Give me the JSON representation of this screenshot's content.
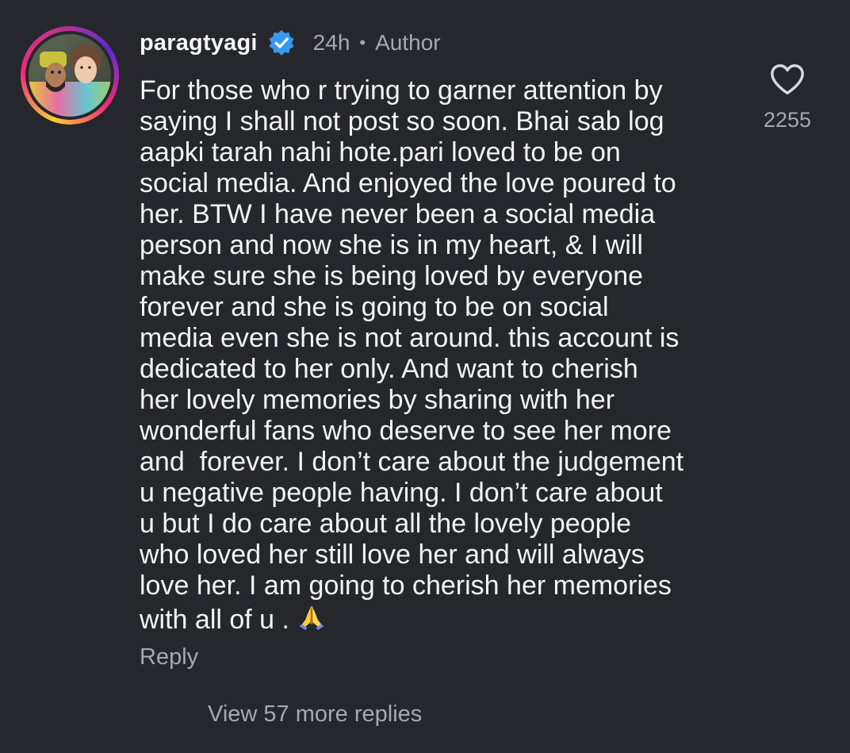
{
  "comment": {
    "username": "paragtyagi",
    "verified_icon": "verified-badge-icon",
    "time": "24h",
    "separator": "•",
    "role": "Author",
    "text": "For those who r trying to garner attention by\nsaying I shall not post so soon. Bhai sab log\naapki tarah nahi hote.pari loved to be on\nsocial media. And enjoyed the love poured to\nher. BTW I have never been a social media\nperson and now she is in my heart, & I will\nmake sure she is being loved by everyone\nforever and she is going to be on social\nmedia even she is not around. this account is\ndedicated to her only. And want to cherish\nher lovely memories by sharing with her\nwonderful fans who deserve to see her more\nand  forever. I don’t care about the judgement\nu negative people having. I don’t care about\nu but I do care about all the lovely people\nwho loved her still love her and will always\nlove her. I am going to cherish her memories\nwith all of u . ",
    "emoji": "folded-hands-emoji",
    "like_icon": "heart-outline-icon",
    "like_count": "2255",
    "reply_label": "Reply",
    "view_more_label": "View 57 more replies"
  },
  "colors": {
    "background": "#25272c",
    "text": "#f3f3f3",
    "secondary_text": "#a8a8ad",
    "verified": "#3897f0"
  }
}
